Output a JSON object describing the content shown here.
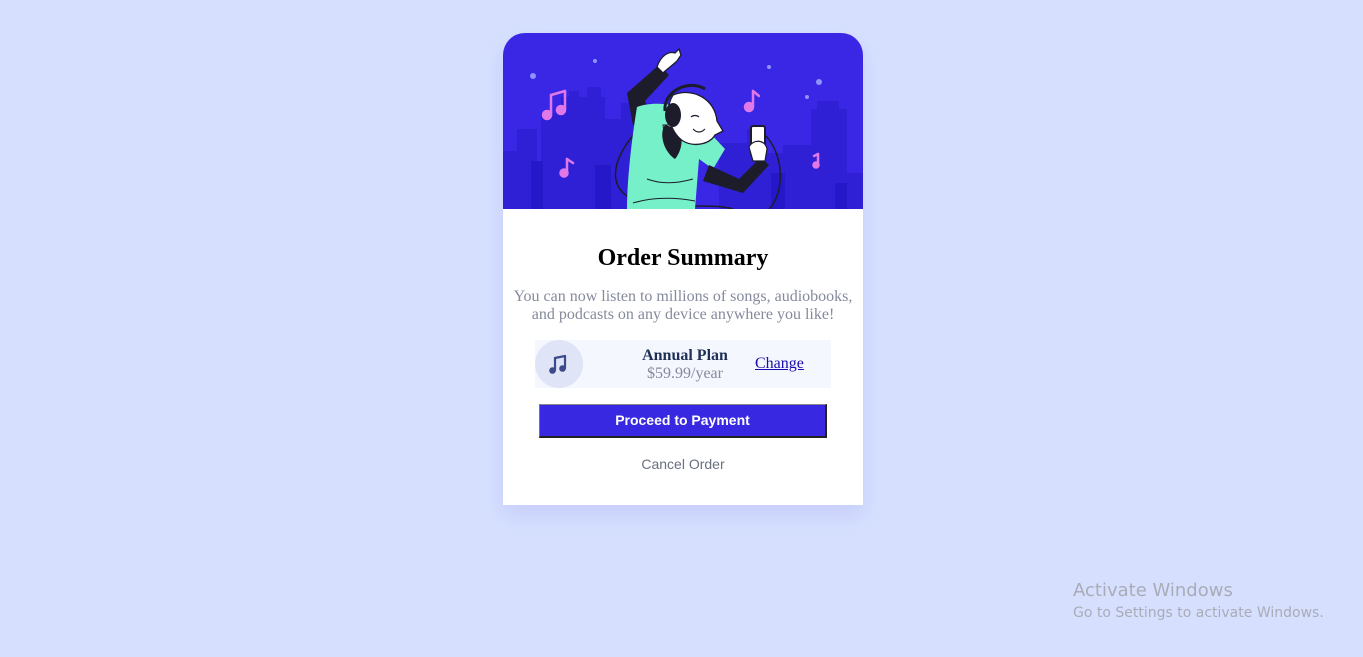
{
  "colors": {
    "page_background": "#d6e0fe",
    "hero_background": "#3a27e6",
    "accent": "#3828e1",
    "title_text": "#000000",
    "muted_text": "#858a9c",
    "plan_name_text": "#1f2f56",
    "link": "#1a0dab",
    "figure_shirt": "#76f0c9",
    "music_note": "#e178e8"
  },
  "hero": {
    "icon": "dancing-person-illustration"
  },
  "summary": {
    "title": "Order Summary",
    "description": "You can now listen to millions of songs, audiobooks, and podcasts on any device anywhere you like!"
  },
  "plan": {
    "icon": "music-note-icon",
    "name": "Annual Plan",
    "price": "$59.99/year",
    "change_label": "Change"
  },
  "actions": {
    "proceed_label": "Proceed to Payment",
    "cancel_label": "Cancel Order"
  },
  "watermark": {
    "title": "Activate Windows",
    "subtitle": "Go to Settings to activate Windows."
  }
}
